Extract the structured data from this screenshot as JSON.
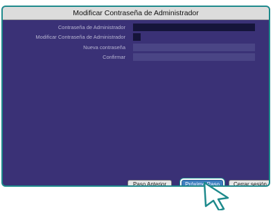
{
  "dialog": {
    "title": "Modificar Contraseña de Administrador",
    "fields": [
      {
        "label": "Contraseña de Administrador",
        "value": ""
      },
      {
        "label": "Modificar Contraseña de Administrador",
        "checked": false
      },
      {
        "label": "Nueva contraseña",
        "value": ""
      },
      {
        "label": "Confirmar",
        "value": ""
      }
    ],
    "buttons": {
      "back": "Paso Anterior",
      "next": "Próximo Paso",
      "logout": "Cerrar sesión"
    }
  },
  "colors": {
    "panel_bg": "#3a3176",
    "border": "#1e8a8c",
    "primary_button": "#3f7fc0"
  },
  "cursor": "pointer-arrow-icon"
}
